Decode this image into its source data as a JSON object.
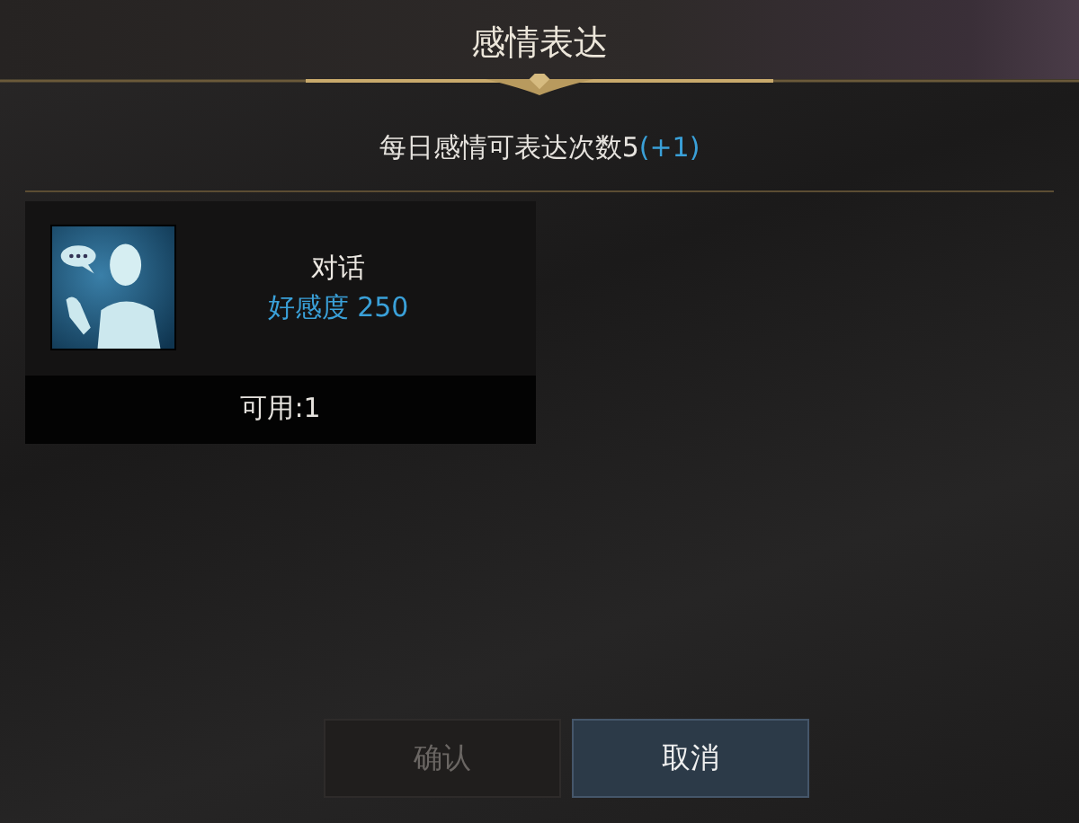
{
  "window": {
    "title": "感情表达"
  },
  "daily": {
    "text": "每日感情可表达次数5",
    "bonus": "(+1)"
  },
  "emotes": [
    {
      "name": "对话",
      "affinity": "好感度 250",
      "available": "可用:1",
      "selected": false
    }
  ],
  "buttons": [
    {
      "label": "确认",
      "disabled": true
    },
    {
      "label": "取消",
      "disabled": false
    }
  ]
}
